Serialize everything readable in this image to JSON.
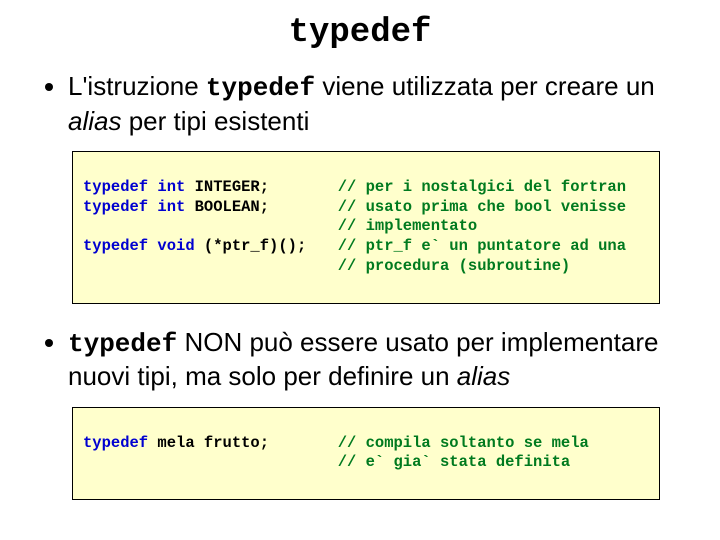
{
  "title": "typedef",
  "bullet1": {
    "pre": "L'istruzione ",
    "kw": "typedef",
    "post1": " viene utilizzata per creare un ",
    "alias": "alias",
    "post2": " per tipi esistenti"
  },
  "code1": {
    "l1_kw": "typedef int ",
    "l1_id": "INTEGER",
    "l1_sc": ";",
    "l2_kw": "typedef int ",
    "l2_id": "BOOLEAN",
    "l2_sc": ";",
    "l3_blank": " ",
    "l4_kw": "typedef void ",
    "l4_id": "(*ptr_f)()",
    "l4_sc": ";",
    "c1": "// per i nostalgici del fortran",
    "c2": "// usato prima che bool venisse",
    "c3": "// implementato",
    "c4": "// ptr_f e` un puntatore ad una",
    "c5": "// procedura (subroutine)"
  },
  "bullet2": {
    "kw": "typedef",
    "post1": " NON può essere usato per implementare nuovi tipi, ma solo per definire un ",
    "alias": "alias"
  },
  "code2": {
    "l1_kw": "typedef ",
    "l1_id": "mela frutto",
    "l1_sc": ";",
    "c1": "// compila soltanto se mela",
    "c2": "// e` gia` stata definita"
  }
}
